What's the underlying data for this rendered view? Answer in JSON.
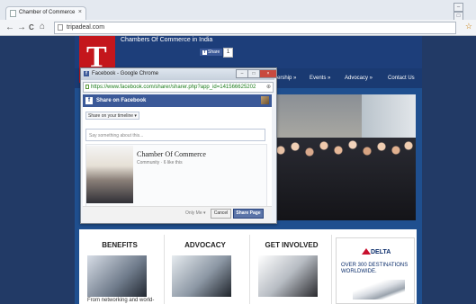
{
  "browser": {
    "tab_label": "Chamber of Commerce",
    "tab_close": "×",
    "back": "←",
    "forward": "→",
    "reload": "C",
    "home": "⌂",
    "url": "tripadeal.com",
    "win_min": "–",
    "win_max": "□"
  },
  "site": {
    "logo_letter": "T",
    "title": "Chambers Of Commerce in India",
    "fb_share_label": "Share",
    "fb_share_count": "1",
    "nav": [
      "ership »",
      "Events »",
      "Advocacy »",
      "Contact Us"
    ],
    "columns": [
      {
        "title": "BENEFITS"
      },
      {
        "title": "ADVOCACY"
      },
      {
        "title": "GET INVOLVED"
      }
    ],
    "benefits_caption": "From networking and world-",
    "ad": {
      "brand": "DELTA",
      "tagline": "OVER 300 DESTINATIONS WORLDWIDE."
    }
  },
  "popup": {
    "window_title": "Facebook - Google Chrome",
    "url": "https://www.facebook.com/sharer/sharer.php?app_id=141566625202",
    "header": "Share on Facebook",
    "share_target": "Share on your timeline ▾",
    "placeholder": "Say something about this...",
    "preview_title": "Chamber Of Commerce",
    "preview_meta": "Community · 6 like this",
    "privacy": "Only Me ▾",
    "cancel": "Cancel",
    "share_button": "Share Page"
  }
}
